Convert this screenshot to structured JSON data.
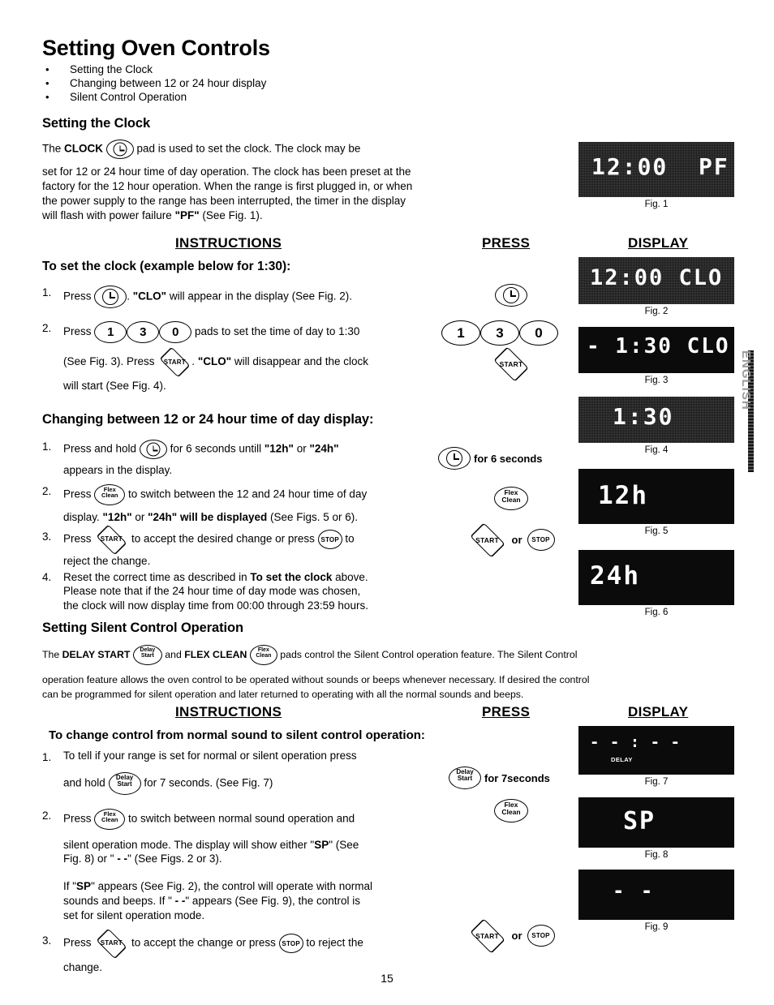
{
  "page": {
    "title": "Setting Oven Controls",
    "page_number": "15",
    "side_tab": "ENGLISH"
  },
  "bullets": [
    {
      "marker": "•",
      "text": "Setting the Clock"
    },
    {
      "marker": "•",
      "text": "Changing between 12  or 24 hour display"
    },
    {
      "marker": "•",
      "text": "Silent Control Operation"
    }
  ],
  "section_clock": {
    "heading": "Setting the Clock",
    "intro_a": "The ",
    "intro_clock_bold": "CLOCK",
    "intro_b": " pad is used to set the clock. The clock may be",
    "intro_rest": "set for 12 or 24 hour time of day operation.  The clock has been preset at the factory for the 12 hour operation.  When the range is first plugged in, or when the power supply to the range has been interrupted, the timer in the display will flash with power failure ",
    "intro_pf": "\"PF\"",
    "intro_tail": " (See Fig. 1)."
  },
  "column_headers_top": {
    "instructions": "INSTRUCTIONS",
    "press": "PRESS",
    "display": "DISPLAY"
  },
  "column_headers_bottom": {
    "instructions": "INSTRUCTIONS",
    "press": "PRESS",
    "display": "DISPLAY"
  },
  "set_clock": {
    "heading": "To set the clock (example below for 1:30):",
    "step1": {
      "num": "1.",
      "a": "Press ",
      "b": ". ",
      "c": "\"CLO\"",
      "d": " will appear in the display (See Fig. 2)."
    },
    "step2": {
      "num": "2.",
      "a": "Press ",
      "pad1": "1",
      "pad2": "3",
      "pad3": "0",
      "b": " pads to set the time of day to 1:30",
      "c": "(See Fig. 3). Press ",
      "start_label": "START",
      "d": ". ",
      "e": "\"CLO\"",
      "f": " will disappear and the clock",
      "g": "will start (See Fig. 4)."
    }
  },
  "change_hours": {
    "heading": "Changing between 12 or 24 hour time of day display:",
    "step1": {
      "num": "1.",
      "a": "Press and hold ",
      "b": " for 6 seconds untill ",
      "c": "\"12h\"",
      "d": " or ",
      "e": "\"24h\"",
      "f": "appears in the display."
    },
    "step2": {
      "num": "2.",
      "a": "Press ",
      "pad_top": "Flex",
      "pad_bottom": "Clean",
      "b": " to switch between the 12 and 24 hour time of day",
      "c": "display.  ",
      "d": "\"12h\"",
      "e": "  or ",
      "f": "\"24h\" will be displayed",
      "g": " (See Figs. 5 or 6)."
    },
    "step3": {
      "num": "3.",
      "a": "Press ",
      "start_label": "START",
      "b": " to accept the desired change or press ",
      "stop_label": "STOP",
      "c": " to",
      "d": "reject the change."
    },
    "step4": {
      "num": "4.",
      "a": "Reset the correct time as described in ",
      "b": "To set the clock",
      "c": " above.",
      "d": "Please note that if the 24 hour time of day mode was chosen,",
      "e": "the clock will now display time from 00:00 through 23:59 hours."
    }
  },
  "silent": {
    "heading": "Setting Silent Control Operation",
    "intro_a": "The ",
    "intro_delay_bold": "DELAY START",
    "delay_pad_top": "Delay",
    "delay_pad_bottom": "Start",
    "intro_b": " and ",
    "intro_flex_bold": "FLEX CLEAN",
    "flex_pad_top": "Flex",
    "flex_pad_bottom": "Clean",
    "intro_c": " pads control the Silent Control operation feature. The Silent Control",
    "intro_line2": "operation feature allows the oven control to be operated without sounds or beeps whenever necessary. If desired the control",
    "intro_line3": "can be programmed for silent operation and later returned to operating with all the normal sounds and beeps."
  },
  "silent_steps": {
    "heading": "To change control from normal sound to silent control operation:",
    "step1": {
      "num": "1.",
      "a": "To tell if your range is set for normal or silent operation press",
      "b": "and hold ",
      "pad_top": "Delay",
      "pad_bottom": "Start",
      "c": " for 7 seconds. (See Fig. 7)"
    },
    "step2": {
      "num": "2.",
      "a": "Press ",
      "pad_top": "Flex",
      "pad_bottom": "Clean",
      "b": " to switch between normal sound operation and",
      "c": "silent operation mode. The display will show either \"",
      "sp": "SP",
      "d": "\" (See",
      "e": "Fig. 8) or \" ",
      "dashes": "- -",
      "f": "\" (See Figs. 2 or 3)."
    },
    "note": {
      "a": "If \"",
      "sp": "SP",
      "b": "\" appears (See Fig. 2), the control will operate with normal",
      "c": "sounds and beeps.  If \" ",
      "dashes": "- -",
      "d": "\" appears (See Fig. 9), the control is",
      "e": "set for silent operation mode."
    },
    "step3": {
      "num": "3.",
      "a": "Press ",
      "start_label": "START",
      "b": " to accept the change or press ",
      "stop_label": "STOP",
      "c": " to reject the",
      "d": "change."
    }
  },
  "press_column": {
    "clock_pad": "clock-pad",
    "pad_1": "1",
    "pad_3": "3",
    "pad_0": "0",
    "start_1": "START",
    "for_6_seconds": "for 6 seconds",
    "flex_top": "Flex",
    "flex_bottom": "Clean",
    "start_2": "START",
    "or_1": "or",
    "stop_2": "STOP",
    "delay_top": "Delay",
    "delay_bottom": "Start",
    "for_7_seconds": "for 7seconds",
    "flex_top_2": "Flex",
    "flex_bottom_2": "Clean",
    "start_3": "START",
    "or_2": "or",
    "stop_3": "STOP"
  },
  "figures": [
    {
      "id": "fig1",
      "display_text": "12:00  PF",
      "caption": "Fig. 1",
      "noisy": true,
      "sublabel": ""
    },
    {
      "id": "fig2",
      "display_text": "12:00 CLO",
      "caption": "Fig. 2",
      "noisy": true,
      "sublabel": ""
    },
    {
      "id": "fig3",
      "display_text": "- 1:30 CLO",
      "caption": "Fig. 3",
      "noisy": false,
      "sublabel": ""
    },
    {
      "id": "fig4",
      "display_text": "1:30",
      "caption": "Fig. 4",
      "noisy": true,
      "sublabel": ""
    },
    {
      "id": "fig5",
      "display_text": "12h",
      "caption": "Fig. 5",
      "noisy": false,
      "sublabel": ""
    },
    {
      "id": "fig6",
      "display_text": "24h",
      "caption": "Fig. 6",
      "noisy": false,
      "sublabel": ""
    },
    {
      "id": "fig7",
      "display_text": "- - : - -",
      "caption": "Fig. 7",
      "noisy": false,
      "sublabel": "DELAY"
    },
    {
      "id": "fig8",
      "display_text": "SP",
      "caption": "Fig. 8",
      "noisy": false,
      "sublabel": ""
    },
    {
      "id": "fig9",
      "display_text": "- -",
      "caption": "Fig. 9",
      "noisy": false,
      "sublabel": ""
    }
  ]
}
